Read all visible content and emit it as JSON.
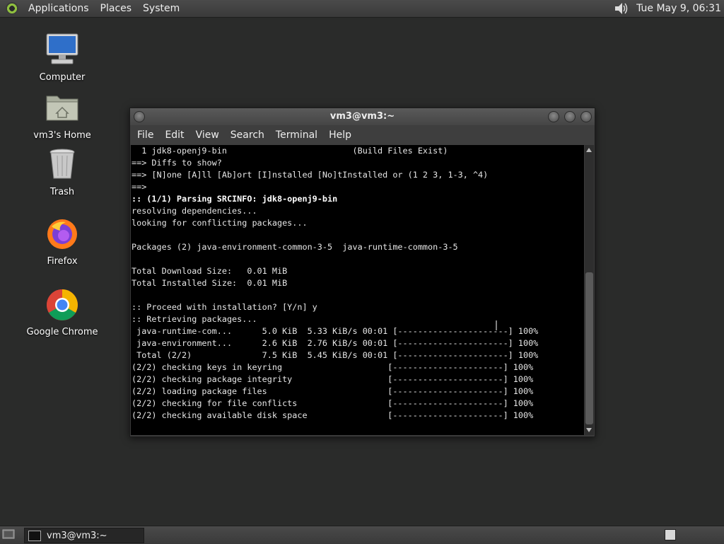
{
  "top_panel": {
    "menus": [
      "Applications",
      "Places",
      "System"
    ],
    "clock": "Tue May  9, 06:31"
  },
  "desktop_icons": [
    {
      "label": "Computer",
      "icon": "computer-icon"
    },
    {
      "label": "vm3's Home",
      "icon": "home-folder-icon"
    },
    {
      "label": "Trash",
      "icon": "trash-icon"
    },
    {
      "label": "Firefox",
      "icon": "firefox-icon"
    },
    {
      "label": "Google Chrome",
      "icon": "chrome-icon"
    }
  ],
  "terminal": {
    "title": "vm3@vm3:~",
    "menu": [
      "File",
      "Edit",
      "View",
      "Search",
      "Terminal",
      "Help"
    ],
    "lines": [
      {
        "text": "  1 jdk8-openj9-bin                         (Build Files Exist)",
        "bold": false
      },
      {
        "text": "==> Diffs to show?",
        "bold": false
      },
      {
        "text": "==> [N]one [A]ll [Ab]ort [I]nstalled [No]tInstalled or (1 2 3, 1-3, ^4)",
        "bold": false
      },
      {
        "text": "==>",
        "bold": false
      },
      {
        "text": ":: (1/1) Parsing SRCINFO: jdk8-openj9-bin",
        "bold": true
      },
      {
        "text": "resolving dependencies...",
        "bold": false
      },
      {
        "text": "looking for conflicting packages...",
        "bold": false
      },
      {
        "text": "",
        "bold": false
      },
      {
        "text": "Packages (2) java-environment-common-3-5  java-runtime-common-3-5",
        "bold": false
      },
      {
        "text": "",
        "bold": false
      },
      {
        "text": "Total Download Size:   0.01 MiB",
        "bold": false
      },
      {
        "text": "Total Installed Size:  0.01 MiB",
        "bold": false
      },
      {
        "text": "",
        "bold": false
      },
      {
        "text": ":: Proceed with installation? [Y/n] y",
        "bold": false
      },
      {
        "text": ":: Retrieving packages...",
        "bold": false
      },
      {
        "text": " java-runtime-com...      5.0 KiB  5.33 KiB/s 00:01 [----------------------] 100%",
        "bold": false
      },
      {
        "text": " java-environment...      2.6 KiB  2.76 KiB/s 00:01 [----------------------] 100%",
        "bold": false
      },
      {
        "text": " Total (2/2)              7.5 KiB  5.45 KiB/s 00:01 [----------------------] 100%",
        "bold": false
      },
      {
        "text": "(2/2) checking keys in keyring                     [----------------------] 100%",
        "bold": false
      },
      {
        "text": "(2/2) checking package integrity                   [----------------------] 100%",
        "bold": false
      },
      {
        "text": "(2/2) loading package files                        [----------------------] 100%",
        "bold": false
      },
      {
        "text": "(2/2) checking for file conflicts                  [----------------------] 100%",
        "bold": false
      },
      {
        "text": "(2/2) checking available disk space                [----------------------] 100%",
        "bold": false
      }
    ]
  },
  "taskbar": {
    "window_button": "vm3@vm3:~"
  }
}
